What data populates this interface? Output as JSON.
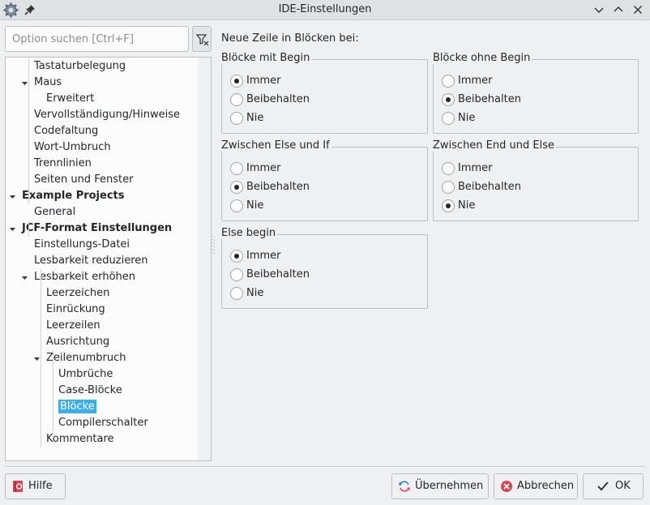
{
  "window": {
    "title": "IDE-Einstellungen",
    "buttons": [
      "minimize",
      "maximize",
      "close"
    ]
  },
  "search": {
    "placeholder": "Option suchen [Ctrl+F]"
  },
  "tree": {
    "items": [
      {
        "label": "Tastaturbelegung",
        "level": 2,
        "expander": "none",
        "bold": false,
        "selected": false
      },
      {
        "label": "Maus",
        "level": 2,
        "expander": "expanded",
        "bold": false,
        "selected": false
      },
      {
        "label": "Erweitert",
        "level": 3,
        "expander": "none",
        "bold": false,
        "selected": false
      },
      {
        "label": "Vervollständigung/Hinweise",
        "level": 2,
        "expander": "none",
        "bold": false,
        "selected": false
      },
      {
        "label": "Codefaltung",
        "level": 2,
        "expander": "none",
        "bold": false,
        "selected": false
      },
      {
        "label": "Wort-Umbruch",
        "level": 2,
        "expander": "none",
        "bold": false,
        "selected": false
      },
      {
        "label": "Trennlinien",
        "level": 2,
        "expander": "none",
        "bold": false,
        "selected": false
      },
      {
        "label": "Seiten und Fenster",
        "level": 2,
        "expander": "none",
        "bold": false,
        "selected": false
      },
      {
        "label": "Example Projects",
        "level": 1,
        "expander": "expanded",
        "bold": true,
        "selected": false
      },
      {
        "label": "General",
        "level": 2,
        "expander": "none",
        "bold": false,
        "selected": false
      },
      {
        "label": "JCF-Format Einstellungen",
        "level": 1,
        "expander": "expanded",
        "bold": true,
        "selected": false
      },
      {
        "label": "Einstellungs-Datei",
        "level": 2,
        "expander": "none",
        "bold": false,
        "selected": false
      },
      {
        "label": "Lesbarkeit reduzieren",
        "level": 2,
        "expander": "none",
        "bold": false,
        "selected": false
      },
      {
        "label": "Lesbarkeit erhöhen",
        "level": 2,
        "expander": "expanded",
        "bold": false,
        "selected": false
      },
      {
        "label": "Leerzeichen",
        "level": 3,
        "expander": "none",
        "bold": false,
        "selected": false
      },
      {
        "label": "Einrückung",
        "level": 3,
        "expander": "none",
        "bold": false,
        "selected": false
      },
      {
        "label": "Leerzeilen",
        "level": 3,
        "expander": "none",
        "bold": false,
        "selected": false
      },
      {
        "label": "Ausrichtung",
        "level": 3,
        "expander": "none",
        "bold": false,
        "selected": false
      },
      {
        "label": "Zeilenumbruch",
        "level": 3,
        "expander": "expanded",
        "bold": false,
        "selected": false
      },
      {
        "label": "Umbrüche",
        "level": 4,
        "expander": "none",
        "bold": false,
        "selected": false
      },
      {
        "label": "Case-Blöcke",
        "level": 4,
        "expander": "none",
        "bold": false,
        "selected": false
      },
      {
        "label": "Blöcke",
        "level": 4,
        "expander": "none",
        "bold": false,
        "selected": true
      },
      {
        "label": "Compilerschalter",
        "level": 4,
        "expander": "none",
        "bold": false,
        "selected": false
      },
      {
        "label": "Kommentare",
        "level": 3,
        "expander": "none",
        "bold": false,
        "selected": false
      }
    ]
  },
  "main": {
    "heading": "Neue Zeile in Blöcken bei:",
    "groups": [
      {
        "title": "Blöcke mit Begin",
        "options": [
          "Immer",
          "Beibehalten",
          "Nie"
        ],
        "selected": 0
      },
      {
        "title": "Blöcke ohne Begin",
        "options": [
          "Immer",
          "Beibehalten",
          "Nie"
        ],
        "selected": 1
      },
      {
        "title": "Zwischen Else und If",
        "options": [
          "Immer",
          "Beibehalten",
          "Nie"
        ],
        "selected": 1
      },
      {
        "title": "Zwischen End und Else",
        "options": [
          "Immer",
          "Beibehalten",
          "Nie"
        ],
        "selected": 2
      },
      {
        "title": "Else begin",
        "options": [
          "Immer",
          "Beibehalten",
          "Nie"
        ],
        "selected": 0
      }
    ]
  },
  "footer": {
    "help": {
      "label": "Hilfe",
      "icon": "help-book-icon"
    },
    "apply": {
      "label": "Übernehmen",
      "icon": "refresh-icon"
    },
    "cancel": {
      "label": "Abbrechen",
      "icon": "cancel-icon"
    },
    "ok": {
      "label": "OK",
      "icon": "checkmark-icon"
    }
  },
  "colors": {
    "selection": "#3daee9",
    "window_bg": "#eff0f1",
    "cancel_red": "#da4453",
    "refresh_blue": "#2980b9"
  }
}
